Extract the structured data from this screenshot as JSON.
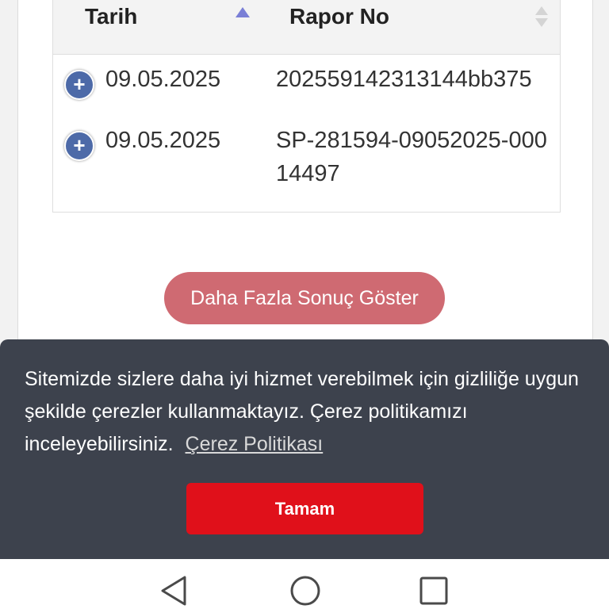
{
  "table": {
    "headers": {
      "date": "Tarih",
      "report_no": "Rapor No"
    },
    "rows": [
      {
        "expand": "+",
        "date": "09.05.2025",
        "report_no": "202559142313144bb375"
      },
      {
        "expand": "+",
        "date": "09.05.2025",
        "report_no": "SP-281594-09052025-00014497"
      }
    ]
  },
  "load_more": {
    "label": "Daha Fazla Sonuç Göster"
  },
  "cookie": {
    "text": "Sitemizde sizlere daha iyi hizmet verebilmek için gizliliğe uygun şekilde çerezler kullanmaktayız. Çerez politikamızı inceleyebilirsiniz.",
    "link_label": "Çerez Politikası",
    "accept_label": "Tamam"
  },
  "icons": {
    "sort_asc": "sort-ascending-icon",
    "sort_both": "sort-both-icon",
    "expand": "plus-circle-icon",
    "nav_back": "triangle-back-icon",
    "nav_home": "circle-home-icon",
    "nav_recent": "square-recent-icon"
  },
  "colors": {
    "expand_button": "#4d6aa8",
    "load_more_button": "#cf6a72",
    "cookie_background": "#3d424d",
    "accept_button": "#e0101a"
  }
}
